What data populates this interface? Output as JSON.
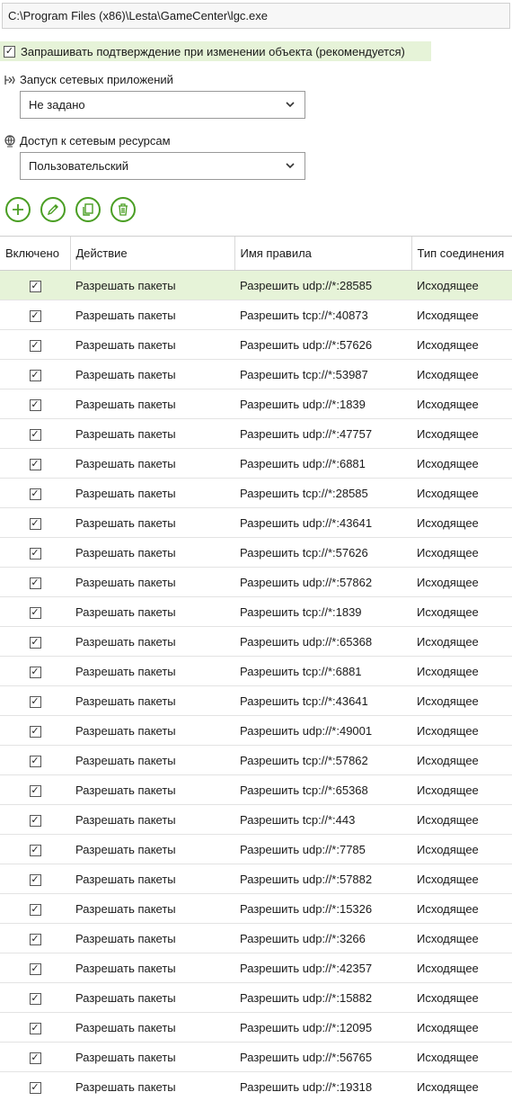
{
  "path": "C:\\Program Files (x86)\\Lesta\\GameCenter\\lgc.exe",
  "confirm": {
    "label": "Запрашивать подтверждение при изменении объекта (рекомендуется)",
    "checked": true
  },
  "network_apps": {
    "label": "Запуск сетевых приложений",
    "value": "Не задано",
    "icon": "network-launch-icon"
  },
  "network_resources": {
    "label": "Доступ к сетевым ресурсам",
    "value": "Пользовательский",
    "icon": "globe-icon"
  },
  "toolbar": {
    "add": "add-icon",
    "edit": "edit-icon",
    "copy": "copy-icon",
    "delete": "delete-icon"
  },
  "accent_color": "#4a9e23",
  "grid": {
    "headers": [
      "Включено",
      "Действие",
      "Имя правила",
      "Тип соединения"
    ],
    "check_mark": "✓",
    "rows": [
      {
        "action": "Разрешать пакеты",
        "name": "Разрешить udp://*:28585",
        "type": "Исходящее"
      },
      {
        "action": "Разрешать пакеты",
        "name": "Разрешить tcp://*:40873",
        "type": "Исходящее"
      },
      {
        "action": "Разрешать пакеты",
        "name": "Разрешить udp://*:57626",
        "type": "Исходящее"
      },
      {
        "action": "Разрешать пакеты",
        "name": "Разрешить tcp://*:53987",
        "type": "Исходящее"
      },
      {
        "action": "Разрешать пакеты",
        "name": "Разрешить udp://*:1839",
        "type": "Исходящее"
      },
      {
        "action": "Разрешать пакеты",
        "name": "Разрешить udp://*:47757",
        "type": "Исходящее"
      },
      {
        "action": "Разрешать пакеты",
        "name": "Разрешить udp://*:6881",
        "type": "Исходящее"
      },
      {
        "action": "Разрешать пакеты",
        "name": "Разрешить tcp://*:28585",
        "type": "Исходящее"
      },
      {
        "action": "Разрешать пакеты",
        "name": "Разрешить udp://*:43641",
        "type": "Исходящее"
      },
      {
        "action": "Разрешать пакеты",
        "name": "Разрешить tcp://*:57626",
        "type": "Исходящее"
      },
      {
        "action": "Разрешать пакеты",
        "name": "Разрешить udp://*:57862",
        "type": "Исходящее"
      },
      {
        "action": "Разрешать пакеты",
        "name": "Разрешить tcp://*:1839",
        "type": "Исходящее"
      },
      {
        "action": "Разрешать пакеты",
        "name": "Разрешить udp://*:65368",
        "type": "Исходящее"
      },
      {
        "action": "Разрешать пакеты",
        "name": "Разрешить tcp://*:6881",
        "type": "Исходящее"
      },
      {
        "action": "Разрешать пакеты",
        "name": "Разрешить tcp://*:43641",
        "type": "Исходящее"
      },
      {
        "action": "Разрешать пакеты",
        "name": "Разрешить udp://*:49001",
        "type": "Исходящее"
      },
      {
        "action": "Разрешать пакеты",
        "name": "Разрешить tcp://*:57862",
        "type": "Исходящее"
      },
      {
        "action": "Разрешать пакеты",
        "name": "Разрешить tcp://*:65368",
        "type": "Исходящее"
      },
      {
        "action": "Разрешать пакеты",
        "name": "Разрешить tcp://*:443",
        "type": "Исходящее"
      },
      {
        "action": "Разрешать пакеты",
        "name": "Разрешить udp://*:7785",
        "type": "Исходящее"
      },
      {
        "action": "Разрешать пакеты",
        "name": "Разрешить udp://*:57882",
        "type": "Исходящее"
      },
      {
        "action": "Разрешать пакеты",
        "name": "Разрешить udp://*:15326",
        "type": "Исходящее"
      },
      {
        "action": "Разрешать пакеты",
        "name": "Разрешить udp://*:3266",
        "type": "Исходящее"
      },
      {
        "action": "Разрешать пакеты",
        "name": "Разрешить udp://*:42357",
        "type": "Исходящее"
      },
      {
        "action": "Разрешать пакеты",
        "name": "Разрешить udp://*:15882",
        "type": "Исходящее"
      },
      {
        "action": "Разрешать пакеты",
        "name": "Разрешить udp://*:12095",
        "type": "Исходящее"
      },
      {
        "action": "Разрешать пакеты",
        "name": "Разрешить udp://*:56765",
        "type": "Исходящее"
      },
      {
        "action": "Разрешать пакеты",
        "name": "Разрешить udp://*:19318",
        "type": "Исходящее"
      }
    ]
  }
}
